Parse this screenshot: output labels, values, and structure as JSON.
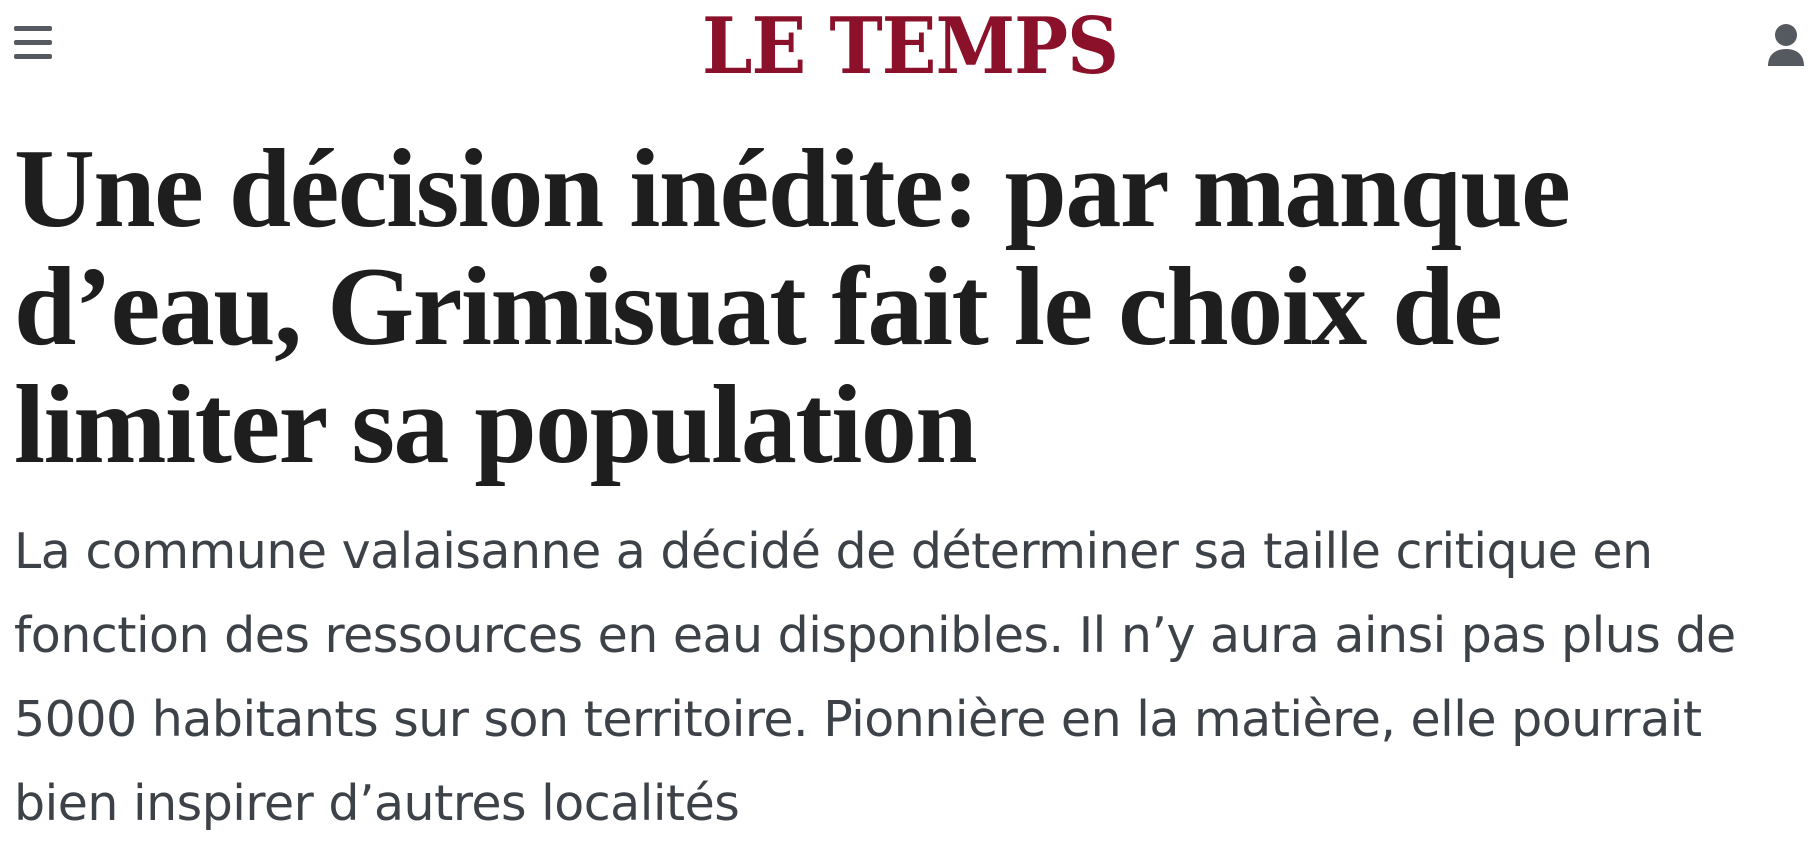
{
  "header": {
    "logo_text": "LE TEMPS",
    "menu_icon": "hamburger-menu-icon",
    "account_icon": "user-icon",
    "brand_color": "#8b1029"
  },
  "article": {
    "headline": "Une décision inédite: par manque d’eau, Grimisuat fait le choix de limiter sa population",
    "lede": "La commune valaisanne a décidé de déterminer sa taille critique en fonction des ressources en eau disponibles. Il n’y aura ainsi pas plus de 5000 habitants sur son territoire. Pionnière en la matière, elle pourrait bien inspirer d’autres localités"
  }
}
